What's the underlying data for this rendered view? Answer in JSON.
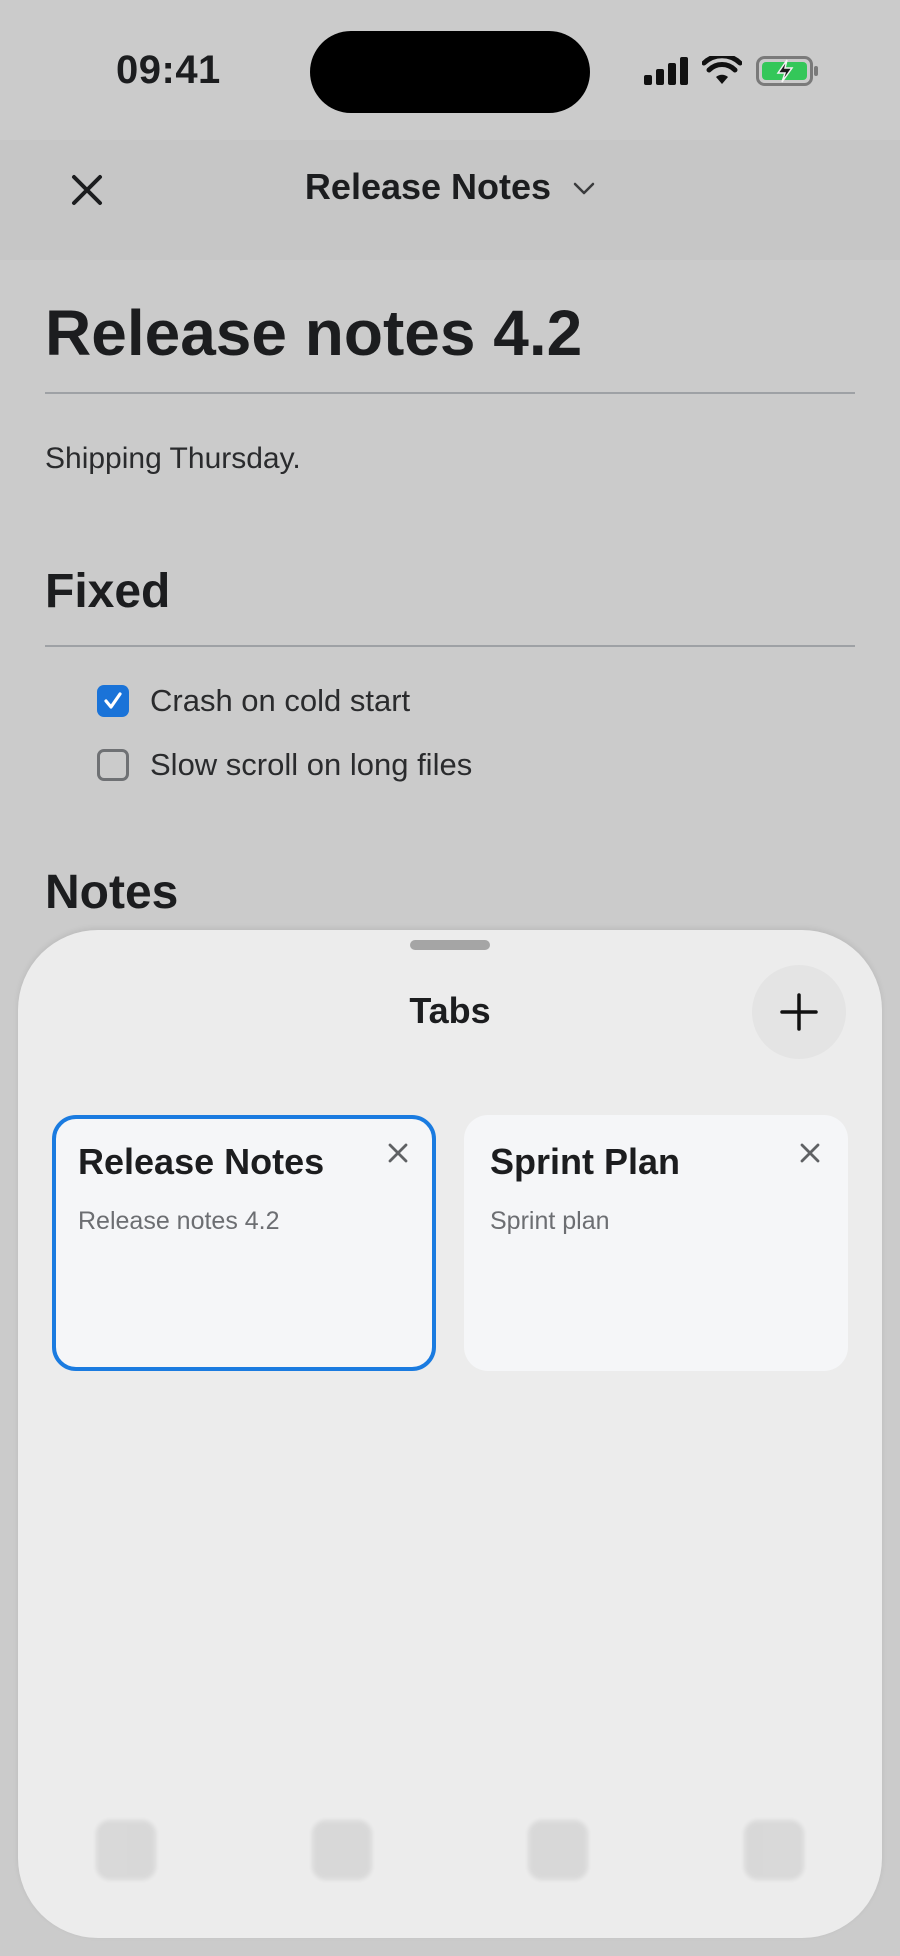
{
  "status": {
    "time": "09:41"
  },
  "nav": {
    "close": "Close",
    "title": "Release Notes"
  },
  "doc": {
    "title": "Release notes 4.2",
    "subtitle": "Shipping Thursday.",
    "section_fixed": "Fixed",
    "tasks": [
      {
        "label": "Crash on cold start",
        "checked": true
      },
      {
        "label": "Slow scroll on long files",
        "checked": false
      }
    ],
    "section_notes": "Notes"
  },
  "sheet": {
    "title": "Tabs",
    "add_label": "New tab",
    "tabs": [
      {
        "title": "Release Notes",
        "subtitle": "Release notes 4.2",
        "selected": true
      },
      {
        "title": "Sprint Plan",
        "subtitle": "Sprint plan",
        "selected": false
      }
    ]
  },
  "colors": {
    "accent": "#1a7be0",
    "checkbox": "#1a73d8",
    "battery": "#34c759"
  },
  "icons": [
    "close-icon",
    "chevron-down-icon",
    "plus-icon",
    "checkbox-checked-icon",
    "checkbox-empty-icon",
    "signal-icon",
    "wifi-icon",
    "battery-charging-icon"
  ]
}
